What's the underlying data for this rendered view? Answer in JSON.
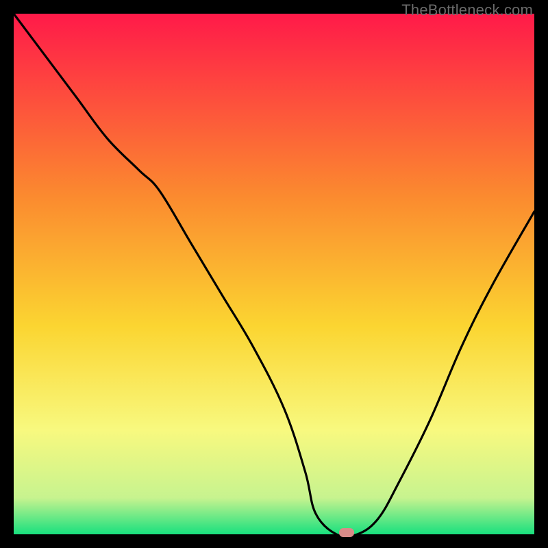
{
  "watermark": "TheBottleneck.com",
  "colors": {
    "gradient_top": "#ff1a49",
    "gradient_mid1": "#fb8a2f",
    "gradient_mid2": "#fbd531",
    "gradient_mid3": "#f8f97f",
    "gradient_mid4": "#c7f38f",
    "gradient_bottom": "#18e07e",
    "curve": "#000000",
    "marker": "#d98b88",
    "frame": "#000000"
  },
  "chart_data": {
    "type": "line",
    "title": "",
    "xlabel": "",
    "ylabel": "",
    "xlim": [
      0,
      100
    ],
    "ylim": [
      0,
      100
    ],
    "series": [
      {
        "name": "bottleneck-curve",
        "x": [
          0,
          6,
          12,
          18,
          24,
          28,
          34,
          40,
          46,
          52,
          56,
          58,
          62,
          66,
          70,
          74,
          80,
          86,
          92,
          100
        ],
        "y": [
          100,
          92,
          84,
          76,
          70,
          66,
          56,
          46,
          36,
          24,
          12,
          4,
          0,
          0,
          3,
          10,
          22,
          36,
          48,
          62
        ]
      }
    ],
    "marker": {
      "x": 64,
      "y": 0,
      "label": "optimal-point"
    },
    "gradient_scale": {
      "meaning": "bottleneck-severity",
      "top_color_meaning": "high",
      "bottom_color_meaning": "none"
    }
  }
}
